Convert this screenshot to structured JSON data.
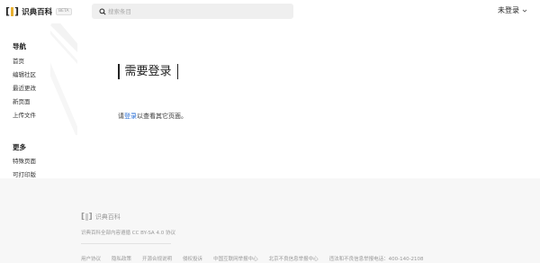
{
  "header": {
    "logo_text": "识典百科",
    "logo_badge": "BETA",
    "search_placeholder": "搜索条目",
    "login_label": "未登录"
  },
  "sidebar": {
    "nav_title": "导航",
    "nav_items": [
      {
        "label": "首页"
      },
      {
        "label": "编辑社区"
      },
      {
        "label": "最近更改"
      },
      {
        "label": "新页面"
      },
      {
        "label": "上传文件"
      }
    ],
    "more_title": "更多",
    "more_items": [
      {
        "label": "特殊页面"
      },
      {
        "label": "可打印版"
      }
    ]
  },
  "main": {
    "title": "需要登录",
    "message_prefix": "请",
    "message_link": "登录",
    "message_suffix": "以查看其它页面。"
  },
  "footer": {
    "logo_text": "识典百科",
    "license": "识典百科全部内容遵循 CC BY-SA 4.0 协议",
    "links": [
      {
        "label": "用户协议"
      },
      {
        "label": "隐私政策"
      },
      {
        "label": "开源合规说明"
      },
      {
        "label": "侵权投诉"
      },
      {
        "label": "中国互联网举报中心"
      },
      {
        "label": "北京不良信息举报中心"
      },
      {
        "label": "违法和不良信息举报电话：400-140-2108"
      }
    ]
  },
  "colors": {
    "accent": "#e8b030",
    "link": "#2a6fd6",
    "footer_bg": "#f7f7f7"
  }
}
